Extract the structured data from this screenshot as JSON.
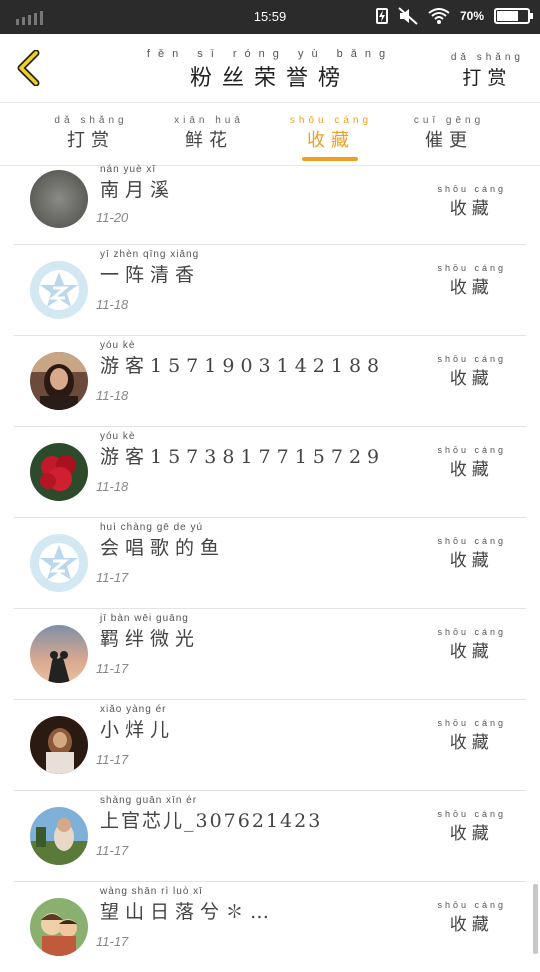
{
  "status_bar": {
    "time": "15:59",
    "battery": "70%",
    "battery_level": 0.7,
    "icons": [
      "signal-icon",
      "charging-icon",
      "mute-icon",
      "wifi-icon",
      "battery-icon"
    ]
  },
  "header": {
    "back_icon": "chevron-left-icon",
    "title_pinyin": "fěn sī róng yù bǎng",
    "title": "粉丝荣誉榜",
    "reward_pinyin": "dǎ shǎng",
    "reward_label": "打赏"
  },
  "tabs": [
    {
      "pinyin": "dǎ shǎng",
      "label": "打赏",
      "active": false
    },
    {
      "pinyin": "xiān huā",
      "label": "鲜花",
      "active": false
    },
    {
      "pinyin": "shōu cáng",
      "label": "收藏",
      "active": true
    },
    {
      "pinyin": "cuī gēng",
      "label": "催更",
      "active": false
    }
  ],
  "accent_color": "#f0a020",
  "items": [
    {
      "name_pinyin": "nán yuè xī",
      "name": "南月溪",
      "date": "11-20",
      "action_pinyin": "shōu cáng",
      "action": "收藏",
      "avatar": "gray-photo"
    },
    {
      "name_pinyin": "yī zhèn qīng xiāng",
      "name": "一阵清香",
      "date": "11-18",
      "action_pinyin": "shōu cáng",
      "action": "收藏",
      "avatar": "default-star"
    },
    {
      "name_pinyin": "yóu kè",
      "name": "游客15719031421​88",
      "date": "11-18",
      "action_pinyin": "shōu cáng",
      "action": "收藏",
      "avatar": "girl-photo"
    },
    {
      "name_pinyin": "yóu kè",
      "name": "游客15738177​15729",
      "date": "11-18",
      "action_pinyin": "shōu cáng",
      "action": "收藏",
      "avatar": "rose-photo"
    },
    {
      "name_pinyin": "huì chàng gē de yú",
      "name": "会唱歌的鱼",
      "date": "11-17",
      "action_pinyin": "shōu cáng",
      "action": "收藏",
      "avatar": "default-star"
    },
    {
      "name_pinyin": "jī bàn wēi guāng",
      "name": "羁绊微光",
      "date": "11-17",
      "action_pinyin": "shōu cáng",
      "action": "收藏",
      "avatar": "sunset-photo"
    },
    {
      "name_pinyin": "xiǎo yàng ér",
      "name": "小烊儿",
      "date": "11-17",
      "action_pinyin": "shōu cáng",
      "action": "收藏",
      "avatar": "dark-photo"
    },
    {
      "name_pinyin": "shàng guān xīn ér",
      "name": "上官芯儿_307621423",
      "date": "11-17",
      "action_pinyin": "shōu cáng",
      "action": "收藏",
      "avatar": "outdoor-photo"
    },
    {
      "name_pinyin": "wàng shān rì luò xī",
      "name": "望山日落兮✽…",
      "date": "11-17",
      "action_pinyin": "shōu cáng",
      "action": "收藏",
      "avatar": "cartoon-photo"
    }
  ]
}
